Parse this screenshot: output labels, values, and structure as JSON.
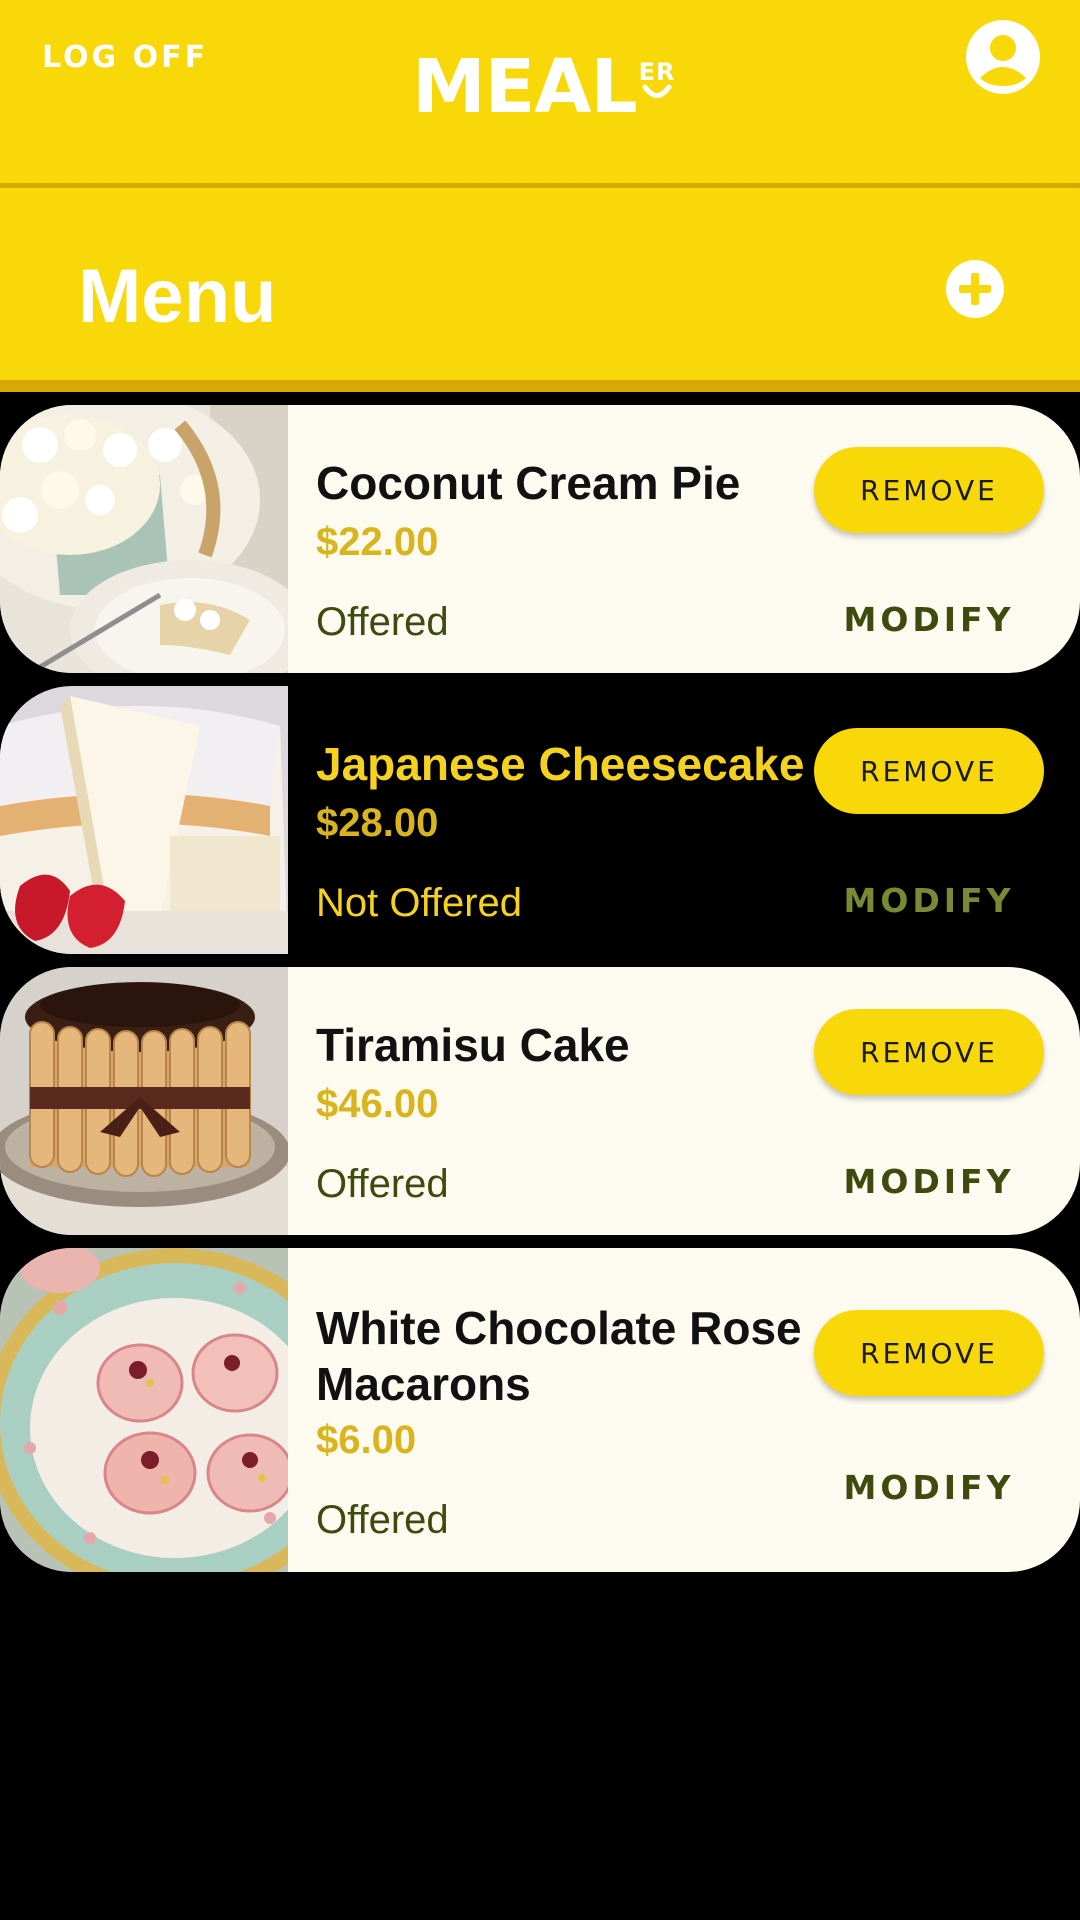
{
  "header": {
    "logoff_label": "LOG OFF",
    "logo_text": "MEAL",
    "logo_superscript": "ER",
    "profile_icon": "account-circle-icon"
  },
  "menu": {
    "title": "Menu",
    "add_icon": "add-circle-icon"
  },
  "items": [
    {
      "name": "Coconut Cream Pie",
      "price": "$22.00",
      "status": "Offered",
      "remove_label": "REMOVE",
      "modify_label": "MODIFY",
      "image": "coconut-cream-pie-photo",
      "highlighted": false
    },
    {
      "name": "Japanese Cheesecake",
      "price": "$28.00",
      "status": "Not Offered",
      "remove_label": "REMOVE",
      "modify_label": "MODIFY",
      "image": "japanese-cheesecake-photo",
      "highlighted": true
    },
    {
      "name": "Tiramisu Cake",
      "price": "$46.00",
      "status": "Offered",
      "remove_label": "REMOVE",
      "modify_label": "MODIFY",
      "image": "tiramisu-cake-photo",
      "highlighted": false
    },
    {
      "name": "White Chocolate Rose Macarons",
      "price": "$6.00",
      "status": "Offered",
      "remove_label": "REMOVE",
      "modify_label": "MODIFY",
      "image": "macarons-photo",
      "highlighted": false
    }
  ],
  "colors": {
    "brand_yellow": "#F8D808",
    "brand_yellow_dark": "#D8A806",
    "price_gold": "#D8B41E",
    "status_olive": "#3E4A0E",
    "card_bg": "#FDFBF0",
    "background": "#000000"
  }
}
